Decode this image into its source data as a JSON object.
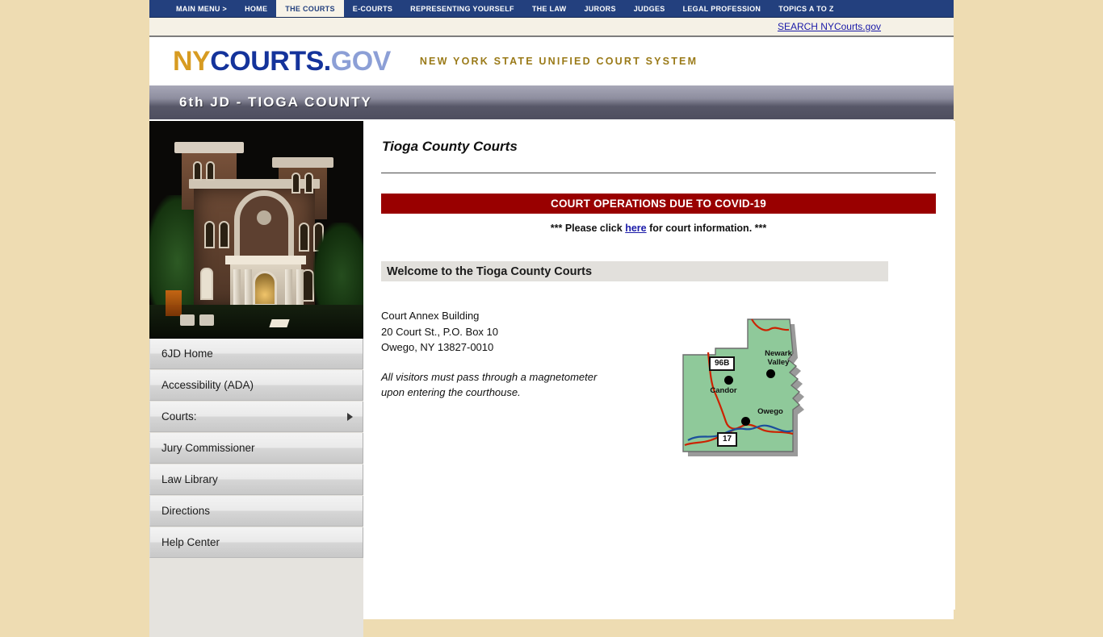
{
  "colors": {
    "page_background": "#eedcb2",
    "nav_blue": "#23407e",
    "nav_active_bg": "#f7f3e8",
    "brand_gold": "#d79b21",
    "brand_blue": "#14339b",
    "brand_light_blue": "#8c9fd6",
    "tagline_gold": "#9a7a18",
    "alert_red": "#990000",
    "link_blue": "#1a1aa8",
    "welcome_bar_gray": "#e2e0dc",
    "sidebar_gray": "#e5e3de",
    "map_green": "#8fc99a",
    "map_road_red": "#cc2200",
    "map_river_blue": "#1b4f9c"
  },
  "topnav": {
    "items": [
      {
        "label": "MAIN MENU >",
        "active": false
      },
      {
        "label": "HOME",
        "active": false
      },
      {
        "label": "THE COURTS",
        "active": true
      },
      {
        "label": "E-COURTS",
        "active": false
      },
      {
        "label": "REPRESENTING YOURSELF",
        "active": false
      },
      {
        "label": "THE LAW",
        "active": false
      },
      {
        "label": "JURORS",
        "active": false
      },
      {
        "label": "JUDGES",
        "active": false
      },
      {
        "label": "LEGAL PROFESSION",
        "active": false
      },
      {
        "label": "TOPICS A TO Z",
        "active": false
      }
    ]
  },
  "search": {
    "link_label": "SEARCH NYCourts.gov"
  },
  "brand": {
    "logo_ny": "NY",
    "logo_courts": "COURTS",
    "logo_dot": ".",
    "logo_gov": "GOV",
    "tagline": "NEW YORK STATE UNIFIED COURT SYSTEM"
  },
  "titlebar": {
    "title": "6th JD - TIOGA COUNTY"
  },
  "sidebar": {
    "photo_alt": "Tioga County Courthouse at night",
    "menu": [
      {
        "label": "6JD Home",
        "has_submenu": false
      },
      {
        "label": "Accessibility (ADA)",
        "has_submenu": false
      },
      {
        "label": "Courts:",
        "has_submenu": true
      },
      {
        "label": "Jury Commissioner",
        "has_submenu": false
      },
      {
        "label": "Law Library",
        "has_submenu": false
      },
      {
        "label": "Directions",
        "has_submenu": false
      },
      {
        "label": "Help Center",
        "has_submenu": false
      }
    ]
  },
  "main": {
    "page_title": "Tioga County Courts",
    "alert_banner": "COURT OPERATIONS DUE TO COVID-19",
    "alert_note_before": "*** Please click",
    "alert_note_link": "here",
    "alert_note_after": "for court information. ***",
    "welcome_heading": "Welcome to the Tioga County Courts",
    "address": {
      "line1": "Court Annex Building",
      "line2": "20 Court St., P.O. Box 10",
      "line3": "Owego, NY 13827-0010"
    },
    "notice_line1": "All visitors must pass through a magnetometer",
    "notice_line2": "upon entering the courthouse."
  },
  "map": {
    "title": "Tioga County map",
    "cities": [
      {
        "name": "Newark Valley",
        "label_line1": "Newark",
        "label_line2": "Valley"
      },
      {
        "name": "Candor",
        "label_line1": "Candor",
        "label_line2": ""
      },
      {
        "name": "Owego",
        "label_line1": "Owego",
        "label_line2": ""
      }
    ],
    "route_shields": [
      {
        "number": "96B"
      },
      {
        "number": "17"
      }
    ]
  }
}
